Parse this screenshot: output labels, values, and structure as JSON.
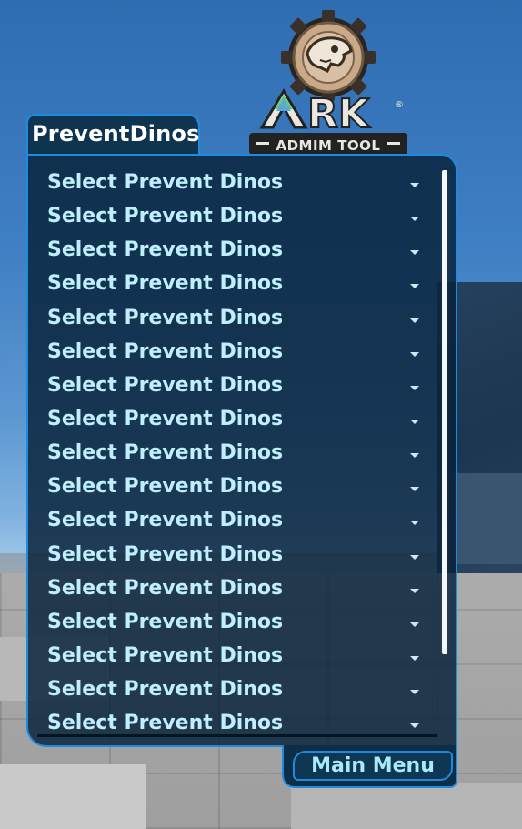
{
  "logo": {
    "brand_text": "ARK",
    "registered_mark": "®",
    "subtitle": "ADMIM TOOL"
  },
  "panel": {
    "tab_title": "PreventDinos",
    "rows": [
      {
        "label": "Select Prevent Dinos"
      },
      {
        "label": "Select Prevent Dinos"
      },
      {
        "label": "Select Prevent Dinos"
      },
      {
        "label": "Select Prevent Dinos"
      },
      {
        "label": "Select Prevent Dinos"
      },
      {
        "label": "Select Prevent Dinos"
      },
      {
        "label": "Select Prevent Dinos"
      },
      {
        "label": "Select Prevent Dinos"
      },
      {
        "label": "Select Prevent Dinos"
      },
      {
        "label": "Select Prevent Dinos"
      },
      {
        "label": "Select Prevent Dinos"
      },
      {
        "label": "Select Prevent Dinos"
      },
      {
        "label": "Select Prevent Dinos"
      },
      {
        "label": "Select Prevent Dinos"
      },
      {
        "label": "Select Prevent Dinos"
      },
      {
        "label": "Select Prevent Dinos"
      },
      {
        "label": "Select Prevent Dinos"
      }
    ]
  },
  "footer": {
    "main_menu_label": "Main Menu"
  },
  "colors": {
    "accent_border": "#1e8ae0",
    "panel_bg": "#08223a",
    "row_text": "#bfeefd",
    "button_text": "#a9eaf8"
  }
}
